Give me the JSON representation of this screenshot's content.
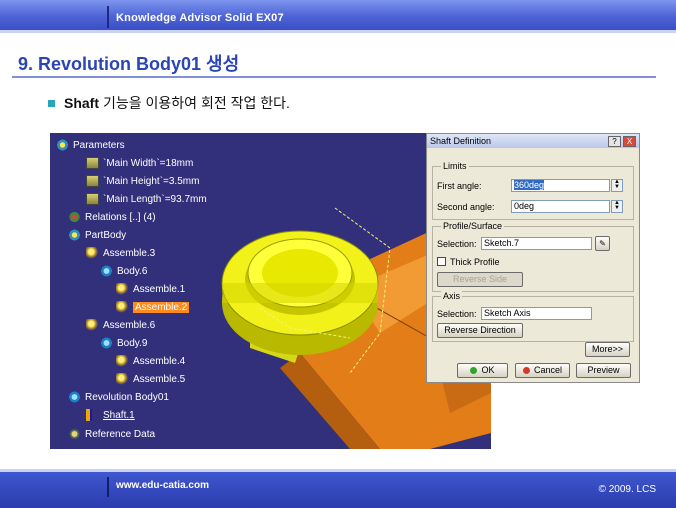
{
  "header": {
    "title": "Knowledge Advisor Solid EX07"
  },
  "slide": {
    "heading_number": "9.",
    "heading_text": "Revolution Body01 생성",
    "bullet_bold": "Shaft",
    "bullet_text": "기능을 이용하여 회전 작업 한다."
  },
  "tree": {
    "items": [
      {
        "label": "Parameters",
        "icon": "parameters-icon"
      },
      {
        "label": "`Main Width`=18mm",
        "icon": "parameter-icon"
      },
      {
        "label": "`Main Height`=3.5mm",
        "icon": "parameter-icon"
      },
      {
        "label": "`Main Length`=93.7mm",
        "icon": "parameter-icon"
      },
      {
        "label": "Relations [..] (4)",
        "icon": "relations-icon"
      },
      {
        "label": "PartBody",
        "icon": "partbody-icon"
      },
      {
        "label": "Assemble.3",
        "icon": "assemble-icon"
      },
      {
        "label": "Body.6",
        "icon": "body-icon"
      },
      {
        "label": "Assemble.1",
        "icon": "assemble-icon"
      },
      {
        "label": "Assemble.2",
        "icon": "assemble-icon"
      },
      {
        "label": "Assemble.6",
        "icon": "assemble-icon"
      },
      {
        "label": "Body.9",
        "icon": "body-icon"
      },
      {
        "label": "Assemble.4",
        "icon": "assemble-icon"
      },
      {
        "label": "Assemble.5",
        "icon": "assemble-icon"
      },
      {
        "label": "Revolution Body01",
        "icon": "body-icon"
      },
      {
        "label": "Shaft.1",
        "icon": "shaft-icon"
      },
      {
        "label": "Reference Data",
        "icon": "reference-icon"
      }
    ]
  },
  "dialog": {
    "title": "Shaft Definition",
    "help_label": "?",
    "close_label": "X",
    "limits_label": "Limits",
    "first_angle_label": "First angle:",
    "first_angle_value": "360deg",
    "second_angle_label": "Second angle:",
    "second_angle_value": "0deg",
    "profile_label": "Profile/Surface",
    "selection_label": "Selection:",
    "profile_value": "Sketch.7",
    "thick_profile_label": "Thick Profile",
    "reverse_side_label": "Reverse Side",
    "axis_label": "Axis",
    "axis_selection_label": "Selection:",
    "axis_value": "Sketch Axis",
    "reverse_direction_label": "Reverse Direction",
    "more_label": "More>>",
    "ok_label": "OK",
    "cancel_label": "Cancel",
    "preview_label": "Preview"
  },
  "footer": {
    "url": "www.edu-catia.com",
    "copyright": "© 2009. LCS"
  },
  "colors": {
    "header_blue": "#4d63d6",
    "heading_blue": "#2b45b5",
    "viewport_bg": "#32307a",
    "highlight_orange": "#ff8a1e"
  }
}
